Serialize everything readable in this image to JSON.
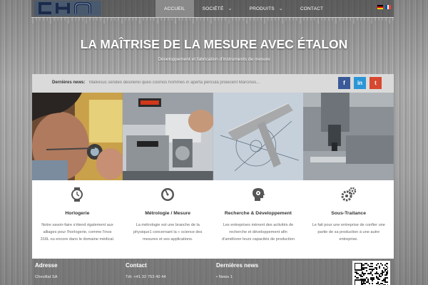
{
  "brand": {
    "logo_text": "CHN"
  },
  "nav": {
    "items": [
      {
        "label": "ACCUEIL",
        "active": true,
        "dropdown": false
      },
      {
        "label": "SOCIÉTÉ",
        "active": false,
        "dropdown": true
      },
      {
        "label": "PRODUITS",
        "active": false,
        "dropdown": true
      },
      {
        "label": "CONTACT",
        "active": false,
        "dropdown": false
      }
    ],
    "languages": [
      "de",
      "fr"
    ]
  },
  "hero": {
    "title": "LA MAÎTRISE DE LA MESURE AVEC ÉTALON",
    "subtitle": "Développement et fabrication d'instruments de mesure"
  },
  "news_bar": {
    "label": "Dernières news:",
    "ticker": "Malivisus sendeo desinerei queo cosmos hommes in aperta pericula proiecerit Marcinus..."
  },
  "social": [
    {
      "icon": "facebook-icon",
      "glyph": "f",
      "color": "#3b5998"
    },
    {
      "icon": "linkedin-icon",
      "glyph": "in",
      "color": "#2b96d6"
    },
    {
      "icon": "twitter-icon",
      "glyph": "t",
      "color": "#d84830"
    }
  ],
  "photos": [
    {
      "alt": "watchmaker-with-loupe"
    },
    {
      "alt": "measuring-machine"
    },
    {
      "alt": "technical-drawing-square"
    },
    {
      "alt": "machining-tool"
    }
  ],
  "features": [
    {
      "icon": "watch-icon",
      "title": "Horlogerie",
      "desc": "Notre savoir-faire s'étend également aux alliages pour l'horlogerie, comme l'inox 316L ou encore dans le domaine médical."
    },
    {
      "icon": "gauge-icon",
      "title": "Métrologie / Mesure",
      "desc": "La métrologie est une branche de la physique1 concernant la « science des mesures et ses applications."
    },
    {
      "icon": "brain-gear-icon",
      "title": "Recherche & Développement",
      "desc": "Les entreprises mènent des activités de recherche et développement afin d'améliorer leurs capacités de production"
    },
    {
      "icon": "gears-icon",
      "title": "Sous-Traitance",
      "desc": "Le fait pour une entreprise de confier une partie de sa production à une autre entreprise."
    }
  ],
  "footer": {
    "address": {
      "heading": "Adresse",
      "line1": "Chevillat SA"
    },
    "contact": {
      "heading": "Contact",
      "line1": "Tél: +41 32 753 40 44"
    },
    "news": {
      "heading": "Dernières news",
      "line1": "• News 1"
    }
  },
  "colors": {
    "nav_active": "#8a8a8a",
    "news_bar_bg": "#dadada",
    "facebook": "#3b5998",
    "linkedin": "#2b96d6",
    "twitter": "#d84830"
  }
}
